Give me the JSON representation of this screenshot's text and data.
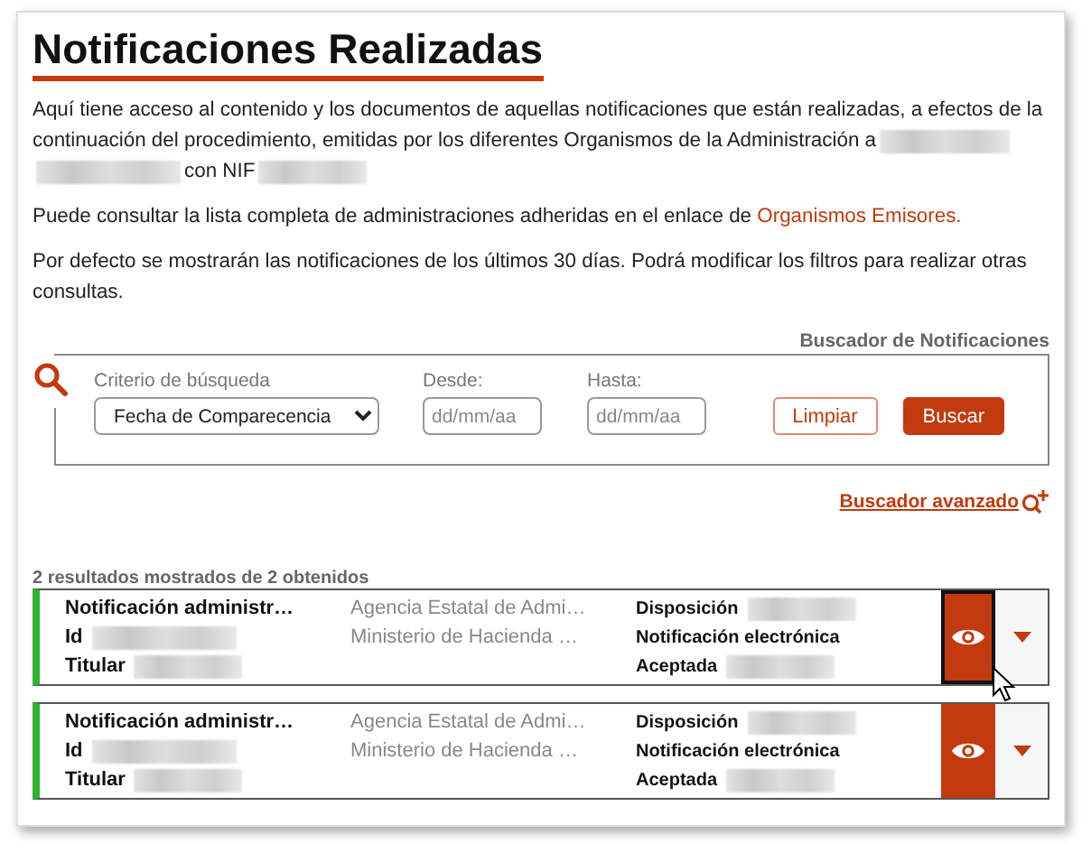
{
  "title": "Notificaciones Realizadas",
  "intro": [
    [
      {
        "kind": "text",
        "text": "Aquí tiene acceso al contenido y los documentos de aquellas notificaciones que están realizadas, a efectos de la"
      }
    ],
    [
      {
        "kind": "text",
        "text": "continuación del procedimiento, emitidas por los diferentes Organismos de la Administración a"
      },
      {
        "kind": "redacted"
      }
    ],
    [
      {
        "kind": "redacted"
      },
      {
        "kind": "text",
        "text": "con NIF"
      },
      {
        "kind": "redacted"
      }
    ]
  ],
  "link_paragraph": {
    "text": "Puede consultar la lista completa de administraciones adheridas en el enlace de ",
    "link": "Organismos Emisores."
  },
  "note": "Por defecto se mostrarán las notificaciones de los últimos 30 días. Podrá modificar los filtros para realizar otras consultas.",
  "search": {
    "legend": "Buscador de Notificaciones",
    "criterion": {
      "label": "Criterio de búsqueda",
      "value": "Fecha de Comparecencia"
    },
    "from": {
      "label": "Desde:",
      "placeholder": "dd/mm/aa"
    },
    "to": {
      "label": "Hasta:",
      "placeholder": "dd/mm/aa"
    },
    "buttons": [
      {
        "kind": "secondary",
        "label": "Limpiar"
      },
      {
        "kind": "primary",
        "label": "Buscar"
      }
    ]
  },
  "advanced_search": "Buscador avanzado",
  "results_summary": "2 resultados mostrados de 2 obtenidos",
  "results": [
    {
      "title": "Notificación administr…",
      "id_label": "Id",
      "holder_label": "Titular",
      "issuer": "Agencia Estatal de Admi…",
      "ministry": "Ministerio de Hacienda …",
      "disposition_label": "Disposición",
      "type": "Notificación electrónica",
      "status_label": "Aceptada",
      "focused": true
    },
    {
      "title": "Notificación administr…",
      "id_label": "Id",
      "holder_label": "Titular",
      "issuer": "Agencia Estatal de Admi…",
      "ministry": "Ministerio de Hacienda …",
      "disposition_label": "Disposición",
      "type": "Notificación electrónica",
      "status_label": "Aceptada",
      "focused": false
    }
  ]
}
